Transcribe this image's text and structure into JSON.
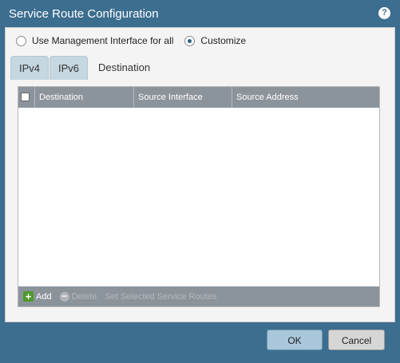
{
  "window": {
    "title": "Service Route Configuration",
    "help_glyph": "?"
  },
  "mode": {
    "options": [
      {
        "label": "Use Management Interface for all",
        "selected": false
      },
      {
        "label": "Customize",
        "selected": true
      }
    ]
  },
  "tabs": [
    {
      "label": "IPv4",
      "active": false
    },
    {
      "label": "IPv6",
      "active": false
    },
    {
      "label": "Destination",
      "active": true
    }
  ],
  "table": {
    "columns": [
      "Destination",
      "Source Interface",
      "Source Address"
    ],
    "rows": []
  },
  "toolbar": {
    "add_label": "Add",
    "delete_label": "Delete",
    "set_label": "Set Selected Service Routes"
  },
  "footer": {
    "ok_label": "OK",
    "cancel_label": "Cancel"
  },
  "colors": {
    "chrome": "#3c6e8f",
    "header": "#8c949b",
    "add": "#4e9a2e",
    "ok_button": "#a9c7da"
  }
}
